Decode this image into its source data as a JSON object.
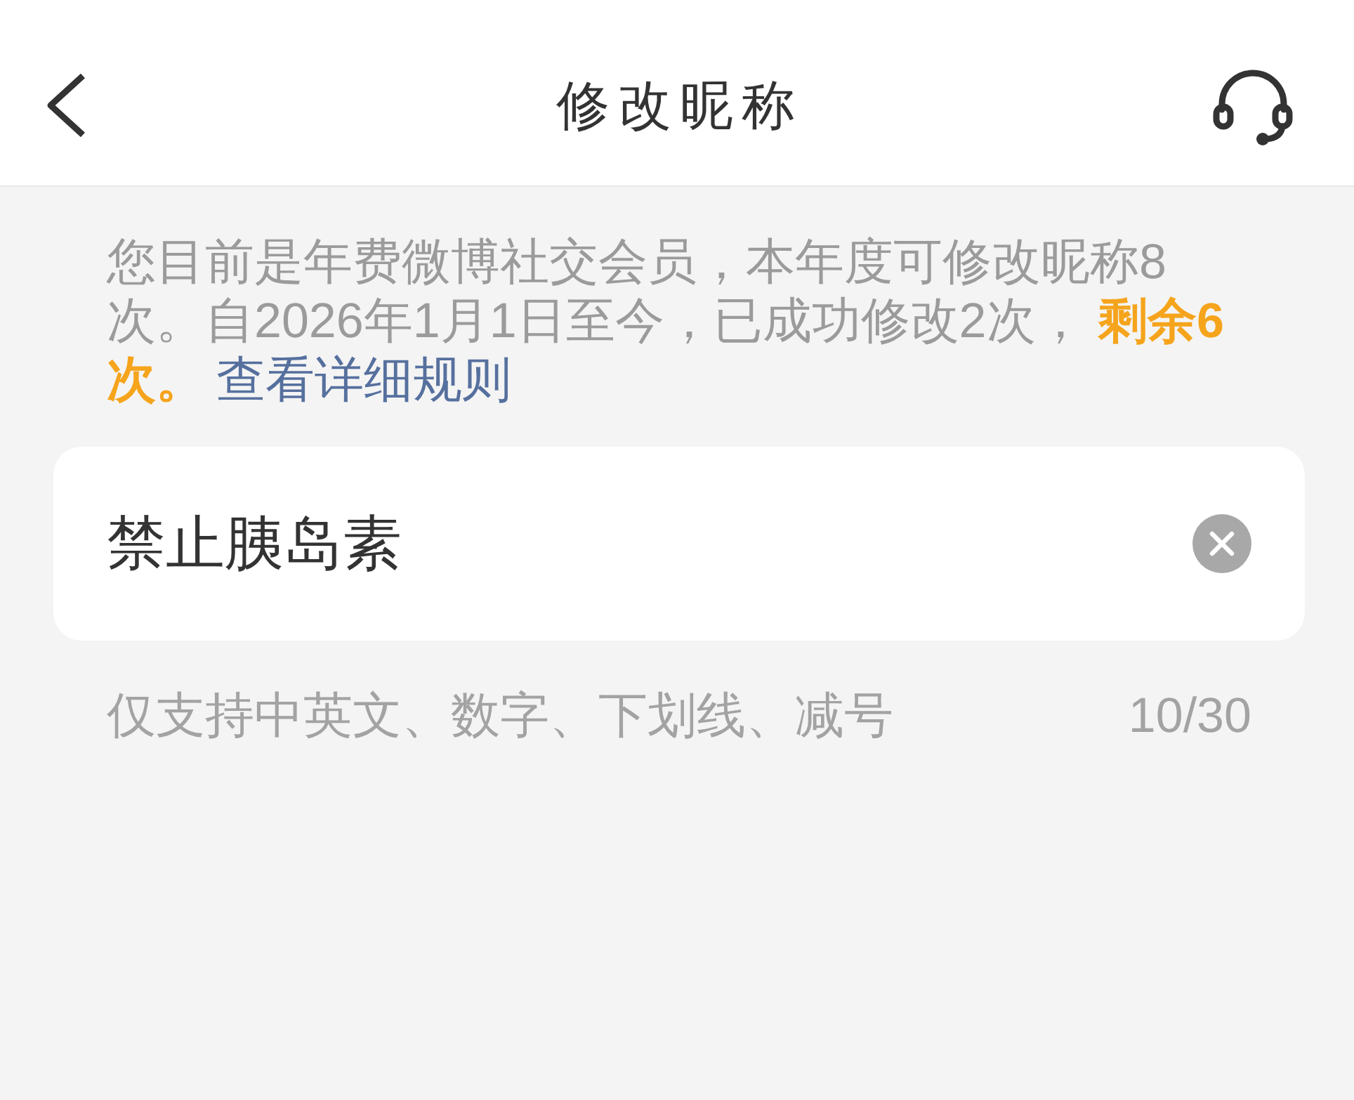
{
  "header": {
    "title": "修改昵称"
  },
  "notice": {
    "text": "您目前是年费微博社交会员，本年度可修改昵称8次。自2026年1月1日至今，已成功修改2次， **剩余6次。**",
    "link": "查看详细规则"
  },
  "nickname_field": {
    "value": "禁止胰岛素"
  },
  "hint": {
    "text": "仅支持中英文、数字、下划线、减号",
    "counter": "10/30"
  }
}
